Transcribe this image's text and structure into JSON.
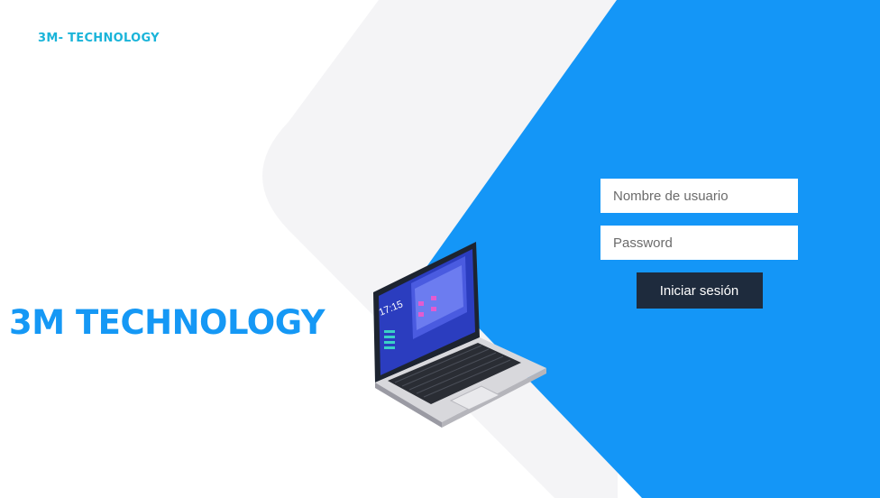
{
  "header": {
    "brand_small": "3M- TECHNOLOGY"
  },
  "hero": {
    "brand_title": "3M TECHNOLOGY"
  },
  "laptop_screen": {
    "clock": "17:15"
  },
  "login": {
    "username_placeholder": "Nombre de usuario",
    "password_placeholder": "Password",
    "submit_label": "Iniciar sesión"
  },
  "colors": {
    "accent_blue": "#1598f5",
    "panel_blue": "#1496f7",
    "brand_small": "#1ab4d9",
    "button_dark": "#1e2b3d",
    "backdrop_gray": "#f4f4f6"
  }
}
